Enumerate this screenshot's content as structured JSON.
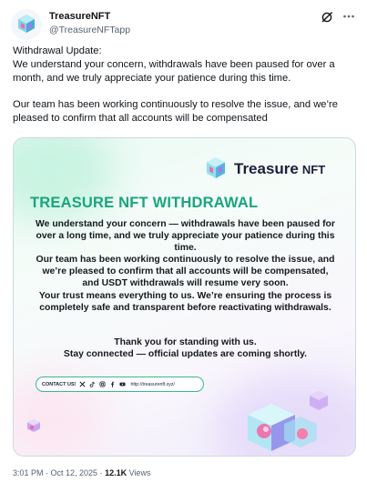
{
  "tweet": {
    "display_name": "TreasureNFT",
    "handle": "@TreasureNFTapp",
    "text_line_1": "Withdrawal Update:",
    "text_line_2": "We understand your concern, withdrawals have been paused for over a",
    "text_line_3": "month, and we truly appreciate your patience during this time.",
    "text_line_4": "Our team has been working continuously to resolve the issue, and we’re",
    "text_line_5": "pleased to confirm that all accounts will be compensated",
    "timestamp": "3:01 PM · Oct 12, 2025 · ",
    "views_count": "12.1K",
    "views_label": " Views"
  },
  "media": {
    "brand_name_strong": "Treasure",
    "brand_name_light": "NFT",
    "title": "TREASURE NFT WITHDRAWAL",
    "body": [
      "We understand your concern — withdrawals have been paused for",
      "over a long time, and we truly appreciate your patience during this",
      "time.",
      "Our team has been working continuously to resolve the issue, and",
      "we’re pleased to confirm that all accounts will be compensated,",
      "and USDT withdrawals will resume very soon.",
      "Your trust means everything to us. We’re ensuring the process is",
      "completely safe and transparent before reactivating withdrawals."
    ],
    "thanks": [
      "Thank you for standing with us.",
      "Stay connected — official updates are coming shortly."
    ],
    "contact_label": "CONTACT US!",
    "contact_url": "http://treasurenft.xyz/",
    "social_icons": [
      "x-icon",
      "tiktok-icon",
      "instagram-icon",
      "facebook-icon",
      "youtube-icon"
    ]
  },
  "colors": {
    "title_green": "#1aa57d",
    "text_dark": "#0f1419",
    "muted": "#536471",
    "border": "#cfd9de",
    "brand_navy": "#1c1f3a"
  }
}
